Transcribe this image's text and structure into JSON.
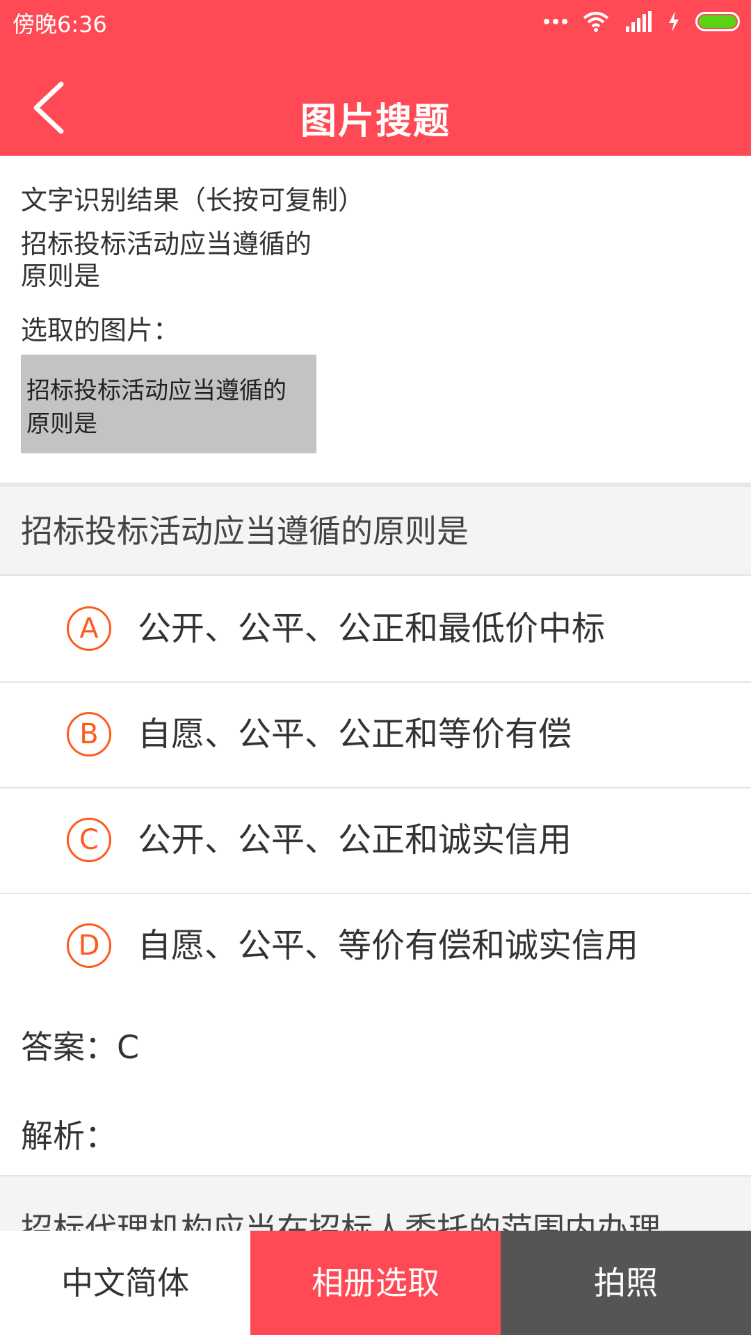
{
  "status_bar": {
    "time": "傍晚6:36",
    "battery_color": "#5ad315",
    "icons": [
      "more-dots-icon",
      "wifi-icon",
      "signal-icon",
      "charging-icon",
      "battery-icon"
    ]
  },
  "header": {
    "title": "图片搜题",
    "background": "#ff4a55",
    "back_icon": "chevron-left-icon"
  },
  "ocr": {
    "label": "文字识别结果（长按可复制）",
    "text": "招标投标活动应当遵循的\n原则是",
    "picked_label": "选取的图片：",
    "picked_image_text": "招标投标活动应当遵循的\n原则是"
  },
  "question": {
    "title": "招标投标活动应当遵循的原则是",
    "options": [
      {
        "letter": "A",
        "text": "公开、公平、公正和最低价中标"
      },
      {
        "letter": "B",
        "text": "自愿、公平、公正和等价有偿"
      },
      {
        "letter": "C",
        "text": "公开、公平、公正和诚实信用"
      },
      {
        "letter": "D",
        "text": "自愿、公平、等价有偿和诚实信用"
      }
    ],
    "answer": "答案：C",
    "analysis": "解析：",
    "accent_color": "#ff5a1e"
  },
  "next_question_preview": "招标代理机构应当在招标人委托的范围内办理",
  "bottom_bar": {
    "language": "中文简体",
    "album": "相册选取",
    "camera": "拍照"
  }
}
